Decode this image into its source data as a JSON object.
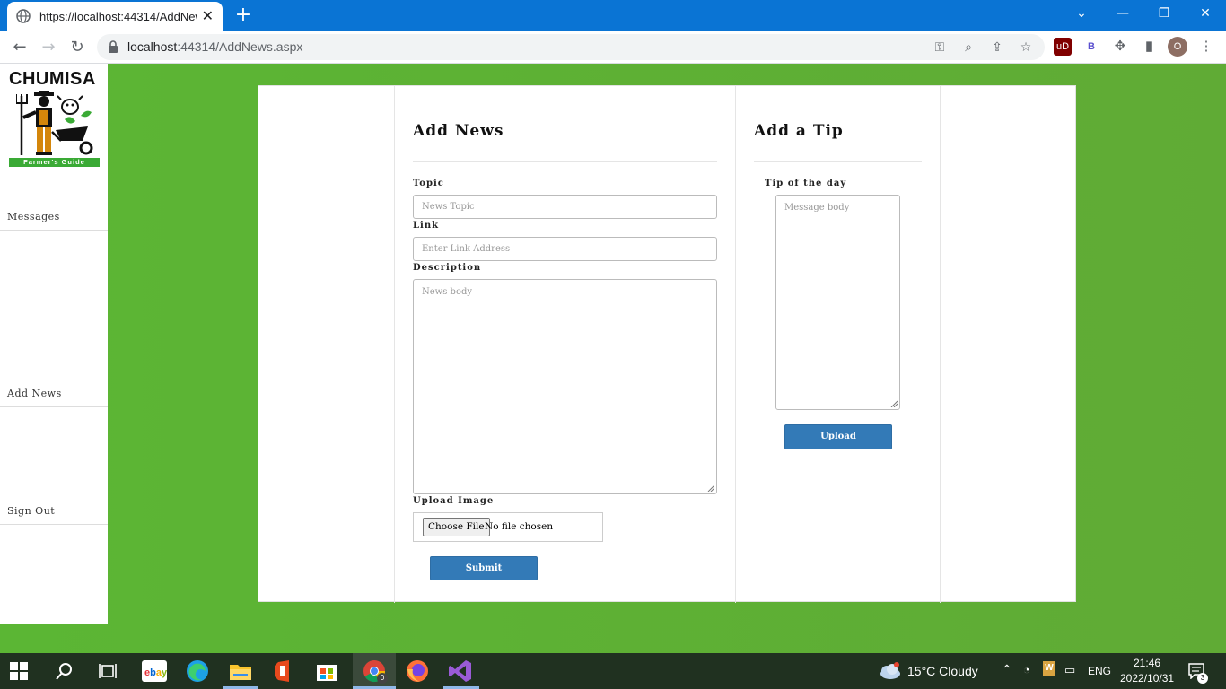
{
  "browser": {
    "tab_title": "https://localhost:44314/AddNews.aspx",
    "url_host": "localhost",
    "url_rest": ":44314/AddNews.aspx",
    "colors": {
      "titlebar": "#0a74d4",
      "toolbar": "#ffffff"
    }
  },
  "sidebar": {
    "logo_title": "CHUMISA",
    "logo_tagline": "Farmer's Guide",
    "items": [
      {
        "label": "Messages"
      },
      {
        "label": "Add News"
      },
      {
        "label": "Sign Out"
      }
    ]
  },
  "news_form": {
    "title": "Add News",
    "topic_label": "Topic",
    "topic_placeholder": "News Topic",
    "link_label": "Link",
    "link_placeholder": "Enter Link Address",
    "description_label": "Description",
    "description_placeholder": "News body",
    "upload_label": "Upload Image",
    "choose_file_label": "Choose File",
    "no_file_text": "No file chosen",
    "submit_label": "Submit"
  },
  "tip_form": {
    "title": "Add a Tip",
    "tip_label": "Tip of the day",
    "tip_placeholder": "Message body",
    "upload_label": "Upload"
  },
  "taskbar": {
    "weather": "15°C  Cloudy",
    "language": "ENG",
    "time": "21:46",
    "date": "2022/10/31",
    "notification_count": "3",
    "chrome_badge": "0"
  },
  "theme": {
    "page_background": "#5bb634",
    "button_color": "#337ab7",
    "taskbar_color": "#203120"
  }
}
